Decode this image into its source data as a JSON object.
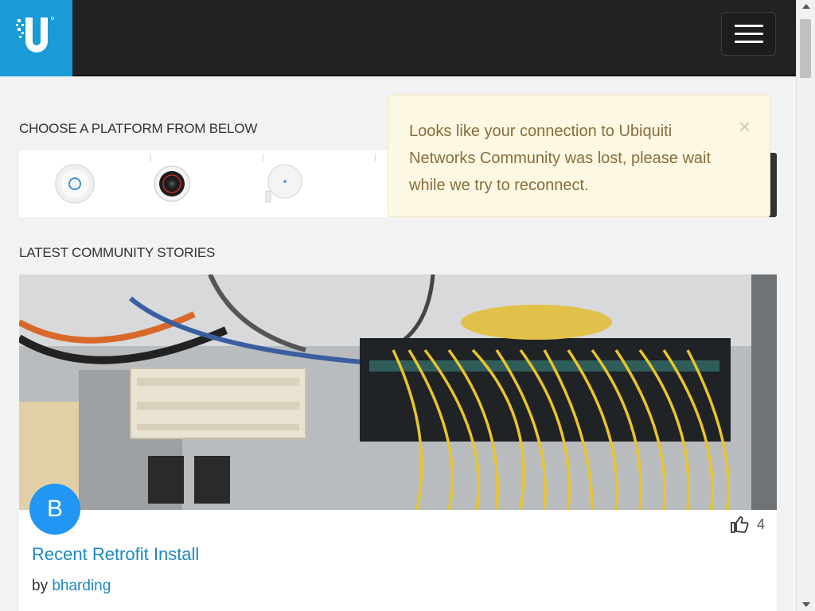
{
  "header": {
    "logo_icon": "ubiquiti-u-logo",
    "menu_icon": "hamburger-menu-icon"
  },
  "platforms": {
    "title": "CHOOSE A PLATFORM FROM BELOW",
    "items": [
      {
        "icon": "unifi-access-point-icon"
      },
      {
        "icon": "unifi-camera-icon"
      },
      {
        "icon": "amplifi-router-icon"
      },
      {
        "icon": "device-icon"
      }
    ]
  },
  "toast": {
    "message": "Looks like your connection to Ubiquiti Networks Community was lost, please wait while we try to reconnect.",
    "close": "×"
  },
  "stories": {
    "title": "LATEST COMMUNITY STORIES",
    "items": [
      {
        "avatar_letter": "B",
        "likes": "4",
        "title": "Recent Retrofit Install",
        "by": "by",
        "author": "bharding"
      }
    ]
  },
  "colors": {
    "brand": "#1a9ad6",
    "header": "#222222",
    "link": "#1b88c2",
    "toast_bg": "#fcf8e3",
    "toast_text": "#8a6d3b",
    "avatar": "#2196f3"
  }
}
